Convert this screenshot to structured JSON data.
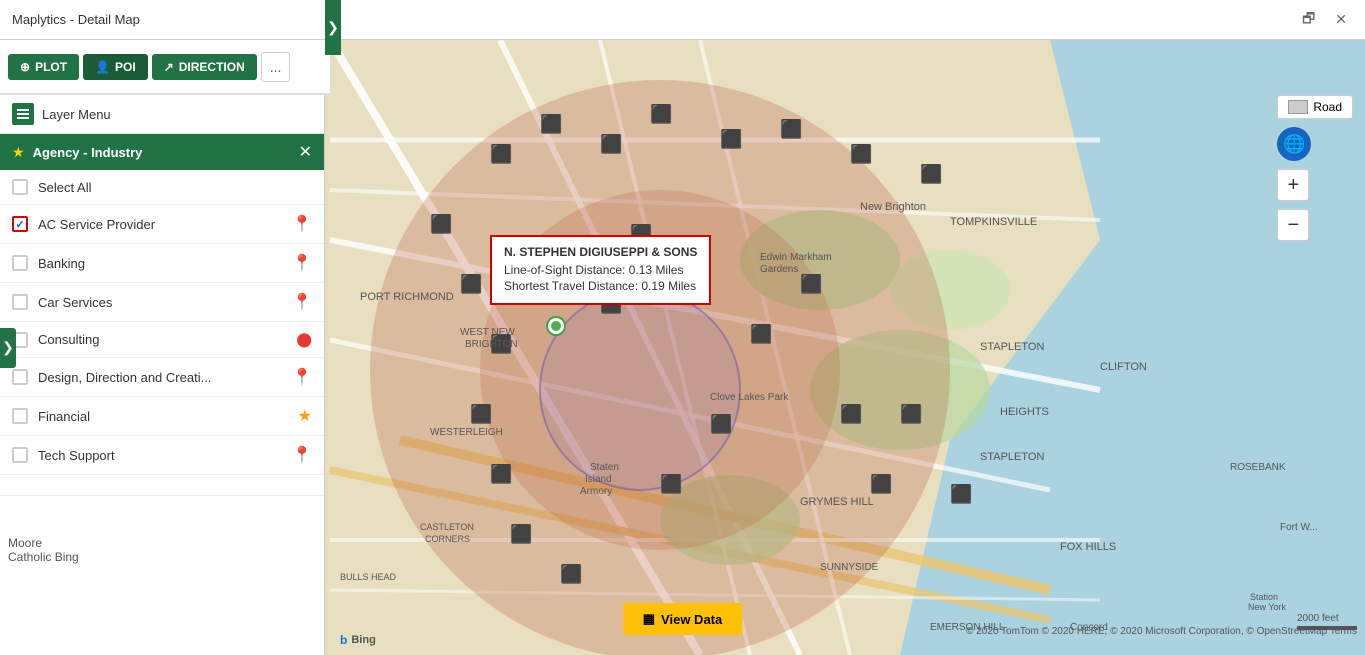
{
  "window": {
    "title": "Maplytics - Detail Map",
    "minimize_label": "🗗",
    "close_label": "✕"
  },
  "toolbar": {
    "plot_label": "PLOT",
    "poi_label": "POI",
    "direction_label": "DIRECTION",
    "more_label": "...",
    "collapse_label": "❮"
  },
  "sidebar": {
    "layer_menu_label": "Layer Menu",
    "filter": {
      "title": "Agency - Industry",
      "close_label": "✕",
      "items": [
        {
          "id": "select_all",
          "label": "Select All",
          "checked": false,
          "pin_color": ""
        },
        {
          "id": "ac_service",
          "label": "AC Service Provider",
          "checked": true,
          "pin_color": "dark"
        },
        {
          "id": "banking",
          "label": "Banking",
          "checked": false,
          "pin_color": "red"
        },
        {
          "id": "car_services",
          "label": "Car Services",
          "checked": false,
          "pin_color": "blue"
        },
        {
          "id": "consulting",
          "label": "Consulting",
          "checked": false,
          "pin_color": "red2"
        },
        {
          "id": "design",
          "label": "Design, Direction and Creati...",
          "checked": false,
          "pin_color": "green"
        },
        {
          "id": "financial",
          "label": "Financial",
          "checked": false,
          "pin_color": "star"
        },
        {
          "id": "tech_support",
          "label": "Tech Support",
          "checked": false,
          "pin_color": "pink"
        }
      ]
    }
  },
  "tooltip": {
    "title": "N. STEPHEN DIGIUSEPPI & SONS",
    "line1_label": "Line-of-Sight Distance:",
    "line1_value": "0.13 Miles",
    "line2_label": "Shortest Travel Distance:",
    "line2_value": "0.19 Miles"
  },
  "map_controls": {
    "road_label": "Road",
    "zoom_in_label": "+",
    "zoom_out_label": "−",
    "expand_label": "❯"
  },
  "bottom": {
    "view_data_label": "View Data",
    "bing_label": "Bing",
    "copyright": "© 2020 TomTom © 2020 HERE, © 2020 Microsoft Corporation, © OpenStreetMap Terms",
    "scale": "2000 feet"
  },
  "moore_catholic": "Moore\nCatholic"
}
